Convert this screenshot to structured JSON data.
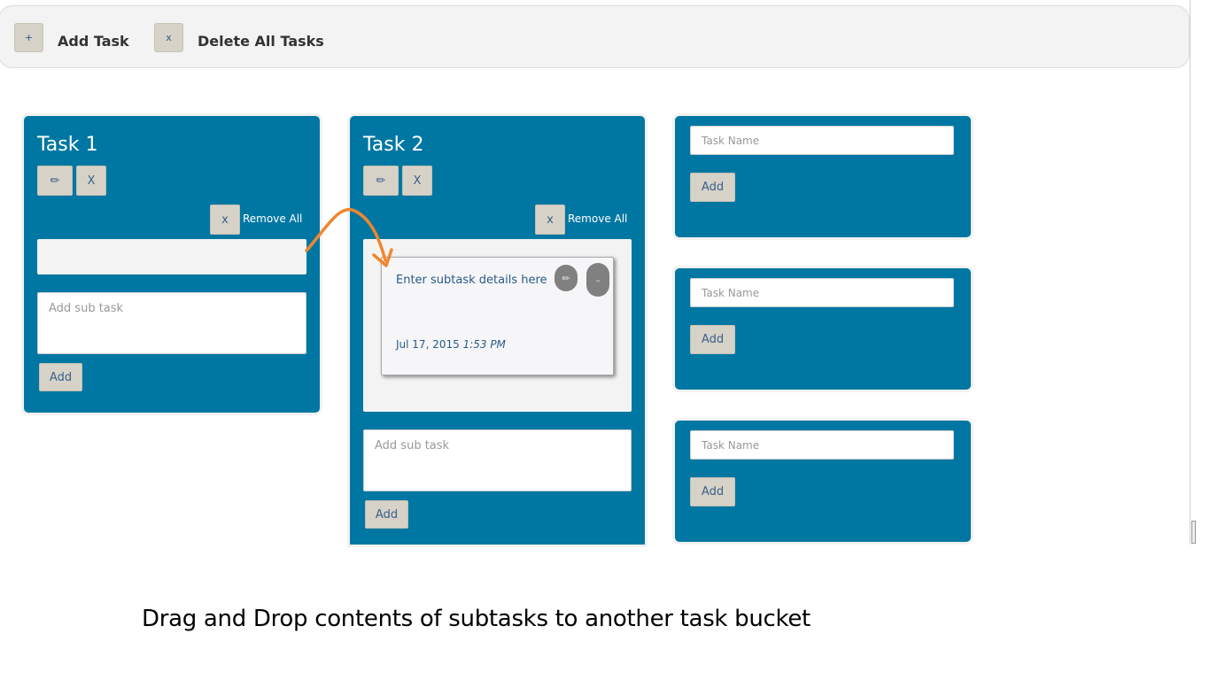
{
  "toolbar": {
    "add_icon": "+",
    "add_label": "Add Task",
    "delete_icon": "x",
    "delete_label": "Delete All Tasks"
  },
  "tasks": [
    {
      "title": "Task 1",
      "edit_icon": "✏",
      "close_icon": "X",
      "remove_icon": "x",
      "remove_label": "Remove All",
      "subtask_placeholder": "Add sub task",
      "add_label": "Add"
    },
    {
      "title": "Task 2",
      "edit_icon": "✏",
      "close_icon": "X",
      "remove_icon": "x",
      "remove_label": "Remove All",
      "subtask_placeholder": "Add sub task",
      "add_label": "Add",
      "subtask": {
        "text": "Enter subtask details here",
        "date": "Jul 17, 2015",
        "time": "1:53 PM",
        "edit_icon": "✏",
        "remove_icon": "–"
      }
    }
  ],
  "new_tasks": [
    {
      "placeholder": "Task Name",
      "add_label": "Add"
    },
    {
      "placeholder": "Task Name",
      "add_label": "Add"
    },
    {
      "placeholder": "Task Name",
      "add_label": "Add"
    }
  ],
  "caption": "Drag and Drop contents of subtasks to another  task bucket",
  "colors": {
    "task_bg": "#0077a2",
    "button_bg": "#d6d2c8",
    "arrow": "#f0862f",
    "pill": "#808080"
  }
}
